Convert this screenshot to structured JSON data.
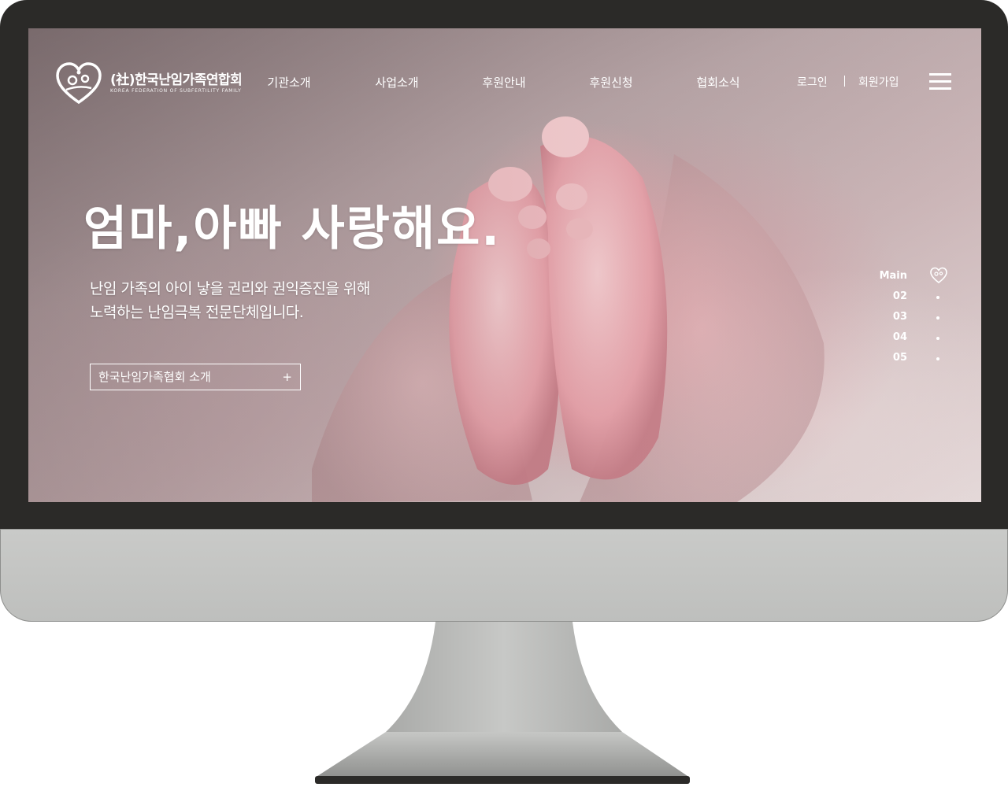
{
  "site": {
    "logo_title": "(社)한국난임가족연합회",
    "logo_subtitle": "KOREA FEDERATION OF SUBFERTILITY FAMILY"
  },
  "nav": {
    "items": [
      {
        "label": "기관소개"
      },
      {
        "label": "사업소개"
      },
      {
        "label": "후원안내"
      },
      {
        "label": "후원신청"
      },
      {
        "label": "협회소식"
      }
    ],
    "login": "로그인",
    "join": "회원가입"
  },
  "hero": {
    "title": "엄마,아빠 사랑해요.",
    "description_line1": "난임 가족의 아이 낳을 권리와 권익증진을 위해",
    "description_line2": "노력하는 난임극복 전문단체입니다.",
    "cta_label": "한국난임가족협회 소개",
    "cta_icon": "+"
  },
  "pager": {
    "items": [
      {
        "label": "Main",
        "active": true
      },
      {
        "label": "02",
        "active": false
      },
      {
        "label": "03",
        "active": false
      },
      {
        "label": "04",
        "active": false
      },
      {
        "label": "05",
        "active": false
      }
    ]
  },
  "colors": {
    "bezel": "#2b2a28",
    "chin": "#c4c5c3",
    "text": "#ffffff"
  }
}
